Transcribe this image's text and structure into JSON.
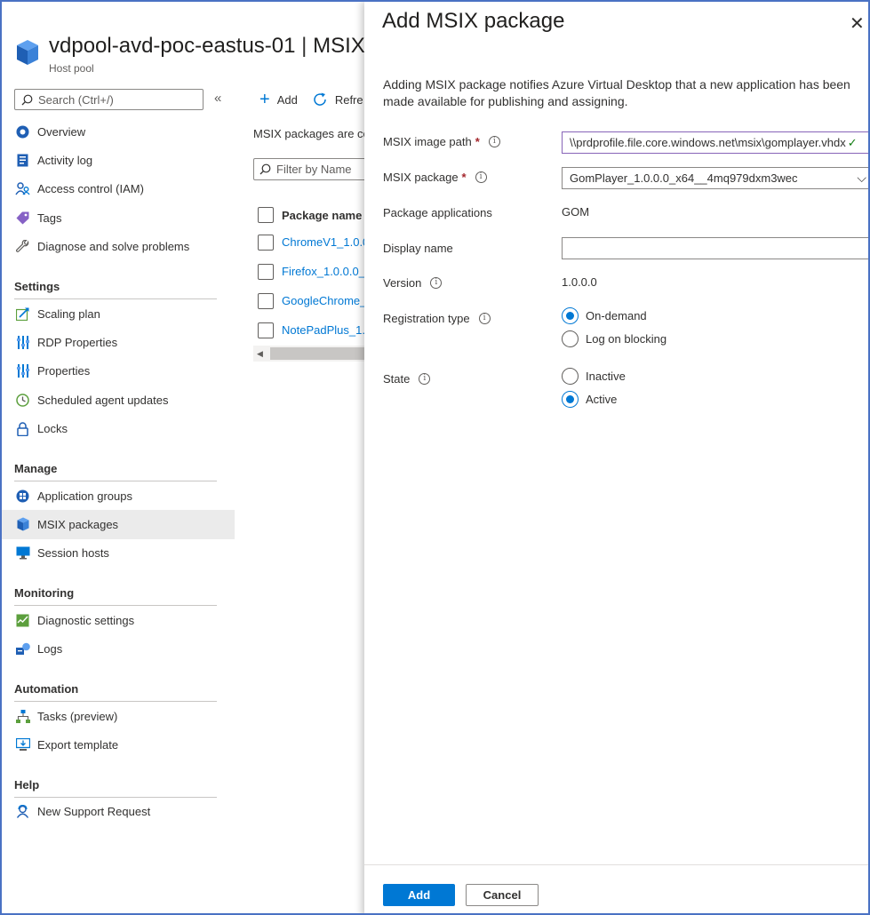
{
  "header": {
    "title_name": "vdpool-avd-poc-eastus-01",
    "title_sep": " | ",
    "title_page": "MSIX",
    "subtitle": "Host pool"
  },
  "sidebar": {
    "search_placeholder": "Search (Ctrl+/)",
    "collapse": "«",
    "groups": [
      {
        "items": [
          "Overview",
          "Activity log",
          "Access control (IAM)",
          "Tags",
          "Diagnose and solve problems"
        ]
      },
      {
        "heading": "Settings",
        "items": [
          "Scaling plan",
          "RDP Properties",
          "Properties",
          "Scheduled agent updates",
          "Locks"
        ]
      },
      {
        "heading": "Manage",
        "items": [
          "Application groups",
          "MSIX packages",
          "Session hosts"
        ]
      },
      {
        "heading": "Monitoring",
        "items": [
          "Diagnostic settings",
          "Logs"
        ]
      },
      {
        "heading": "Automation",
        "items": [
          "Tasks (preview)",
          "Export template"
        ]
      },
      {
        "heading": "Help",
        "items": [
          "New Support Request"
        ]
      }
    ],
    "active_item": "MSIX packages"
  },
  "toolbar": {
    "add_label": "Add",
    "refresh_label": "Refre"
  },
  "main": {
    "description": "MSIX packages are co",
    "filter_placeholder": "Filter by Name",
    "column_header": "Package name",
    "rows": [
      "ChromeV1_1.0.0",
      "Firefox_1.0.0.0_x",
      "GoogleChrome_",
      "NotePadPlus_1.0"
    ]
  },
  "panel": {
    "title": "Add MSIX package",
    "close": "✕",
    "description": "Adding MSIX package notifies Azure Virtual Desktop that a new application has been made available for publishing and assigning.",
    "image_path_label": "MSIX image path",
    "image_path_value": "\\\\prdprofile.file.core.windows.net\\msix\\gomplayer.vhdx",
    "package_label": "MSIX package",
    "package_value": "GomPlayer_1.0.0.0_x64__4mq979dxm3wec",
    "apps_label": "Package applications",
    "apps_value": "GOM",
    "display_name_label": "Display name",
    "display_name_value": "",
    "version_label": "Version",
    "version_value": "1.0.0.0",
    "registration_label": "Registration type",
    "registration_options": [
      "On-demand",
      "Log on blocking"
    ],
    "registration_selected": "On-demand",
    "state_label": "State",
    "state_options": [
      "Inactive",
      "Active"
    ],
    "state_selected": "Active",
    "required_mark": "*",
    "add_button": "Add",
    "cancel_button": "Cancel"
  },
  "colors": {
    "accent": "#0078d4",
    "frame": "#4a72c4",
    "required": "#a4262c",
    "valid": "#107c10"
  }
}
